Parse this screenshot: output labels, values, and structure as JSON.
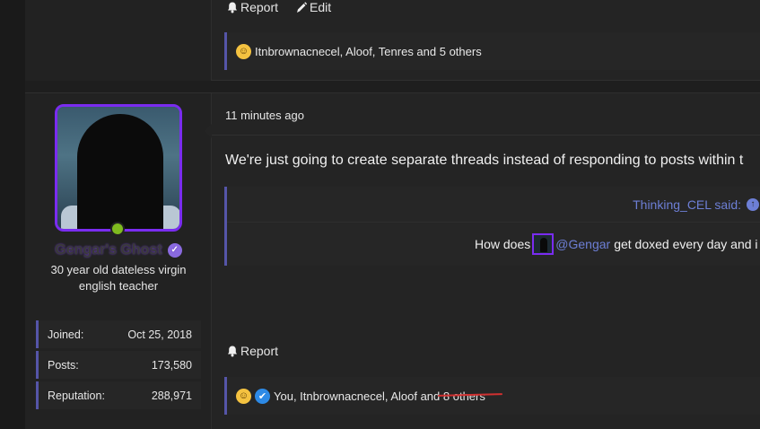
{
  "prev_post": {
    "actions": {
      "report_label": "Report",
      "edit_label": "Edit"
    },
    "reactions_text": "Itnbrownacnecel, Aloof, Tenres and 5 others"
  },
  "post": {
    "user": {
      "name": "Gengar's Ghost",
      "title_line1": "30 year old dateless virgin",
      "title_line2": "english teacher",
      "stats": [
        {
          "label": "Joined:",
          "value": "Oct 25, 2018"
        },
        {
          "label": "Posts:",
          "value": "173,580"
        },
        {
          "label": "Reputation:",
          "value": "288,971"
        }
      ]
    },
    "timestamp": "11 minutes ago",
    "body": "We're just going to create separate threads instead of responding to posts within t",
    "quote": {
      "author": "Thinking_CEL said:",
      "text_before": "How does",
      "mention": "@Gengar",
      "text_after": "get doxed every day and i"
    },
    "actions": {
      "report_label": "Report"
    },
    "reactions_text": "You, Itnbrownacnecel, Aloof and 8 others"
  },
  "colors": {
    "accent": "#5555a8",
    "link": "#6d7fd6",
    "avatar_border": "#7a2cf0",
    "online": "#7fba1f"
  }
}
